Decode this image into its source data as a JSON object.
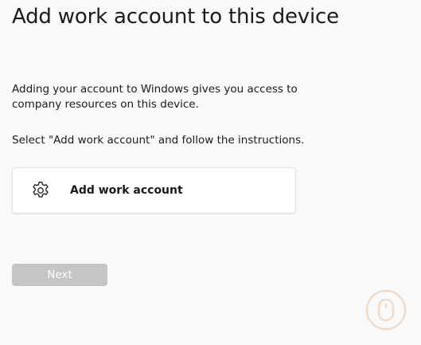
{
  "header": {
    "title": "Add work account to this device"
  },
  "content": {
    "description": "Adding your account to Windows gives you access to company resources on this device.",
    "instruction": "Select \"Add work account\" and follow the instructions."
  },
  "options": [
    {
      "label": "Add work account",
      "icon": "gear-icon"
    }
  ],
  "footer": {
    "next_label": "Next",
    "next_enabled": false
  },
  "colors": {
    "background": "#f9f9f9",
    "card": "#ffffff",
    "button_disabled": "#c5c5c5",
    "watermark": "#f0a060"
  }
}
